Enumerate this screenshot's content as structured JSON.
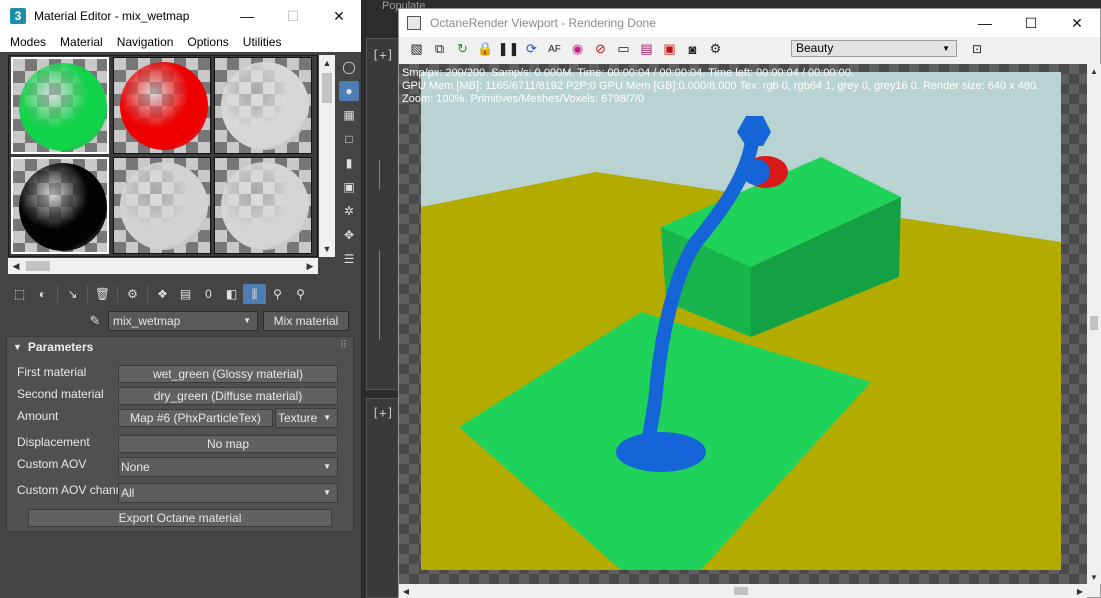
{
  "background": {
    "populate_label": "Populate",
    "viewport_label_1": "[+]",
    "viewport_label_2": "[+]"
  },
  "material_editor": {
    "title": "Material Editor - mix_wetmap",
    "app_icon": "3",
    "window_controls": {
      "minimize": "—",
      "maximize": "☐",
      "close": "✕"
    },
    "menu": [
      "Modes",
      "Material",
      "Navigation",
      "Options",
      "Utilities"
    ],
    "slots": [
      {
        "color": "#11d44a",
        "icon": "sphere-green"
      },
      {
        "color": "#ee0000",
        "icon": "sphere-red"
      },
      {
        "color": "#d7d7d7",
        "icon": "sphere-grey"
      },
      {
        "color": "#030303",
        "icon": "sphere-black"
      },
      {
        "color": "#d2d2d2",
        "icon": "sphere-grey"
      },
      {
        "color": "#d5d5d5",
        "icon": "sphere-grey"
      }
    ],
    "material_name": "mix_wetmap",
    "material_type": "Mix material",
    "parameters": {
      "header": "Parameters",
      "first_material_label": "First material",
      "first_material_value": "wet_green (Glossy material)",
      "second_material_label": "Second material",
      "second_material_value": "dry_green (Diffuse material)",
      "amount_label": "Amount",
      "amount_value": "Map #6 (PhxParticleTex)",
      "amount_type": "Texture",
      "displacement_label": "Displacement",
      "displacement_value": "No map",
      "custom_aov_label": "Custom AOV",
      "custom_aov_value": "None",
      "custom_aov_channel_label": "Custom AOV channel",
      "custom_aov_channel_value": "All",
      "export_button": "Export Octane material"
    }
  },
  "octane": {
    "title": "OctaneRender Viewport - Rendering Done",
    "window_controls": {
      "minimize": "—",
      "maximize": "☐",
      "close": "✕"
    },
    "kernel": "Beauty",
    "stats": {
      "line1": "Smp/px: 200/200.   Samp/s: 0.000M.   Time: 00:00:04 / 00:00:04.   Time left: 00:00:04 / 00:00:00.",
      "line2": "GPU Mem [MB]: 1165/6711/8192 P2P:0   GPU Mem [GB]:0.000/8.000   Tex: rgb 0, rgb64 1, grey 0, grey16 0.   Render size: 640 x 480.",
      "line3": "Zoom: 100%.   Primitives/Meshes/Voxels: 6798/7/0"
    },
    "colors": {
      "floor": "#b3ab00",
      "sky": "#b8d3d1",
      "green": "#1fd35a",
      "liquid": "#1565d8",
      "teapot_red": "#d81a1a"
    }
  }
}
